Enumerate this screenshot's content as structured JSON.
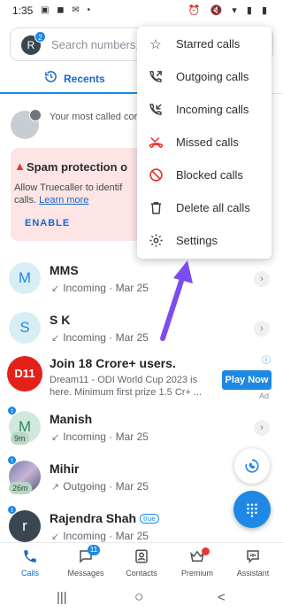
{
  "status_bar": {
    "time": "1:35",
    "left_icons": "▣ ◼ ✉ •",
    "right_icons": "⏰ 🔇 ▾ ▮ ▮"
  },
  "search": {
    "avatar_letter": "R",
    "avatar_badge": "2",
    "placeholder": "Search numbers, n"
  },
  "tabs": {
    "recents": "Recents"
  },
  "most_called": {
    "text": "Your most called cor access. Keep calling"
  },
  "spam_card": {
    "title": "Spam protection o",
    "body": "Allow Truecaller to identif calls.",
    "link": "Learn more",
    "action": "ENABLE"
  },
  "menu": {
    "items": [
      {
        "label": "Starred calls",
        "icon": "star-outline-icon"
      },
      {
        "label": "Outgoing calls",
        "icon": "outgoing-call-icon"
      },
      {
        "label": "Incoming calls",
        "icon": "incoming-call-icon"
      },
      {
        "label": "Missed calls",
        "icon": "missed-call-icon"
      },
      {
        "label": "Blocked calls",
        "icon": "block-icon"
      },
      {
        "label": "Delete all calls",
        "icon": "trash-icon"
      },
      {
        "label": "Settings",
        "icon": "gear-icon"
      }
    ]
  },
  "calls": [
    {
      "initial": "M",
      "name": "MMS",
      "direction": "Incoming",
      "date": "Mar 25"
    },
    {
      "initial": "S",
      "name": "S K",
      "direction": "Incoming",
      "date": "Mar 25"
    },
    {
      "initial": "M",
      "name": "Manish",
      "direction": "Incoming",
      "date": "Mar 25",
      "duration": "9m",
      "badge": "t"
    },
    {
      "initial": "",
      "name": "Mihir",
      "direction": "Outgoing",
      "date": "Mar 25",
      "duration": "26m",
      "badge": "t"
    },
    {
      "initial": "r",
      "name": "Rajendra Shah",
      "tag": "true",
      "direction": "Incoming",
      "date": "Mar 25",
      "badge": "t"
    }
  ],
  "ad": {
    "logo_text": "D11",
    "title": "Join 18 Crore+ users.",
    "desc": "Dream11 - ODI World Cup 2023 is here. Minimum first prize 1.5 Cr+ ...",
    "button": "Play Now",
    "label": "Ad",
    "info": "ⓘ"
  },
  "nav": {
    "items": [
      {
        "label": "Calls"
      },
      {
        "label": "Messages",
        "badge": "11"
      },
      {
        "label": "Contacts"
      },
      {
        "label": "Premium"
      },
      {
        "label": "Assistant"
      }
    ]
  },
  "system_nav": {
    "recent": "|||",
    "home": "○",
    "back": "<"
  }
}
